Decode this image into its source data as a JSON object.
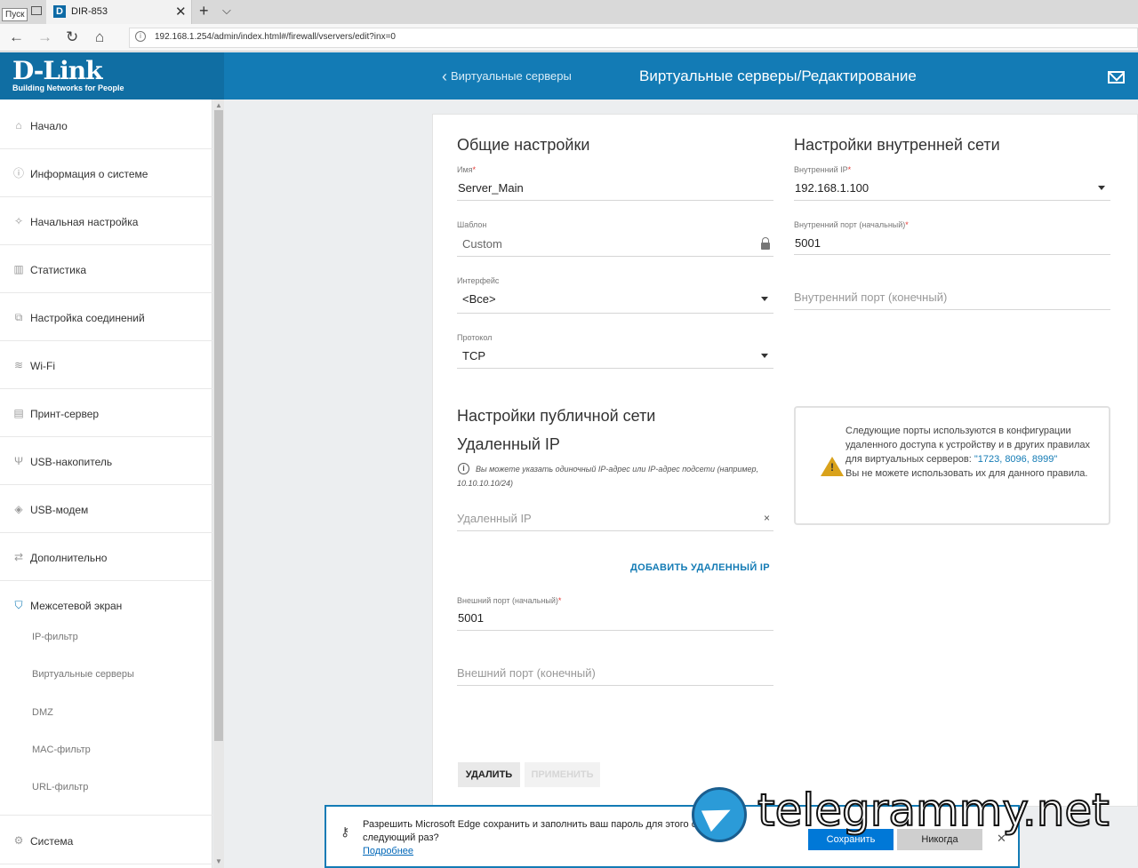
{
  "browser": {
    "start_label": "Пуск",
    "tab_favicon": "D",
    "tab_title": "DIR-853",
    "tab_close": "✕",
    "new_tab": "+",
    "tab_list": "⌵",
    "nav": {
      "back": "←",
      "forward": "→",
      "refresh": "↻",
      "home": "⌂"
    },
    "url": "192.168.1.254/admin/index.html#/firewall/vservers/edit?inx=0"
  },
  "header": {
    "logo": "D-Link",
    "tagline": "Building Networks for People",
    "back_link": "Виртуальные серверы",
    "title": "Виртуальные серверы/Редактирование"
  },
  "sidebar": {
    "items": [
      {
        "label": "Начало",
        "icon": "home-icon"
      },
      {
        "label": "Информация о системе",
        "icon": "info-icon"
      },
      {
        "label": "Начальная настройка",
        "icon": "wand-icon"
      },
      {
        "label": "Статистика",
        "icon": "chart-icon"
      },
      {
        "label": "Настройка соединений",
        "icon": "connections-icon"
      },
      {
        "label": "Wi-Fi",
        "icon": "wifi-icon"
      },
      {
        "label": "Принт-сервер",
        "icon": "printer-icon"
      },
      {
        "label": "USB-накопитель",
        "icon": "usb-icon"
      },
      {
        "label": "USB-модем",
        "icon": "modem-icon"
      },
      {
        "label": "Дополнительно",
        "icon": "sliders-icon"
      },
      {
        "label": "Межсетевой экран",
        "icon": "shield-icon"
      }
    ],
    "firewall_sub": [
      "IP-фильтр",
      "Виртуальные серверы",
      "DMZ",
      "MAC-фильтр",
      "URL-фильтр"
    ],
    "system": {
      "label": "Система",
      "icon": "gear-icon"
    }
  },
  "general": {
    "heading": "Общие настройки",
    "name_label": "Имя",
    "name_value": "Server_Main",
    "template_label": "Шаблон",
    "template_value": "Custom",
    "interface_label": "Интерфейс",
    "interface_value": "<Все>",
    "protocol_label": "Протокол",
    "protocol_value": "TCP"
  },
  "internal": {
    "heading": "Настройки внутренней сети",
    "ip_label": "Внутренний IP",
    "ip_value": "192.168.1.100",
    "port_start_label": "Внутренний порт (начальный)",
    "port_start_value": "5001",
    "port_end_placeholder": "Внутренний порт (конечный)"
  },
  "public": {
    "heading": "Настройки публичной сети",
    "remote_heading": "Удаленный IP",
    "hint": "Вы можете указать одиночный IP-адрес или IP-адрес подсети (например, 10.10.10.10/24)",
    "remote_placeholder": "Удаленный IP",
    "clear": "×",
    "add_remote": "ДОБАВИТЬ УДАЛЕННЫЙ IP",
    "ext_start_label": "Внешний порт (начальный)",
    "ext_start_value": "5001",
    "ext_end_placeholder": "Внешний порт (конечный)"
  },
  "warning": {
    "text_before": "Следующие порты используются в конфигурации удаленного доступа к устройству и в других правилах для виртуальных серверов: ",
    "ports": "\"1723, 8096, 8999\"",
    "text_after": "Вы не можете использовать их для данного правила."
  },
  "actions": {
    "delete": "УДАЛИТЬ",
    "apply": "ПРИМЕНИТЬ"
  },
  "prompt": {
    "text": "Разрешить Microsoft Edge сохранить и заполнить ваш пароль для этого сайта в следующий раз?",
    "more": "Подробнее",
    "save": "Сохранить",
    "never": "Никогда",
    "close": "✕"
  },
  "watermark": "telegrammy.net"
}
